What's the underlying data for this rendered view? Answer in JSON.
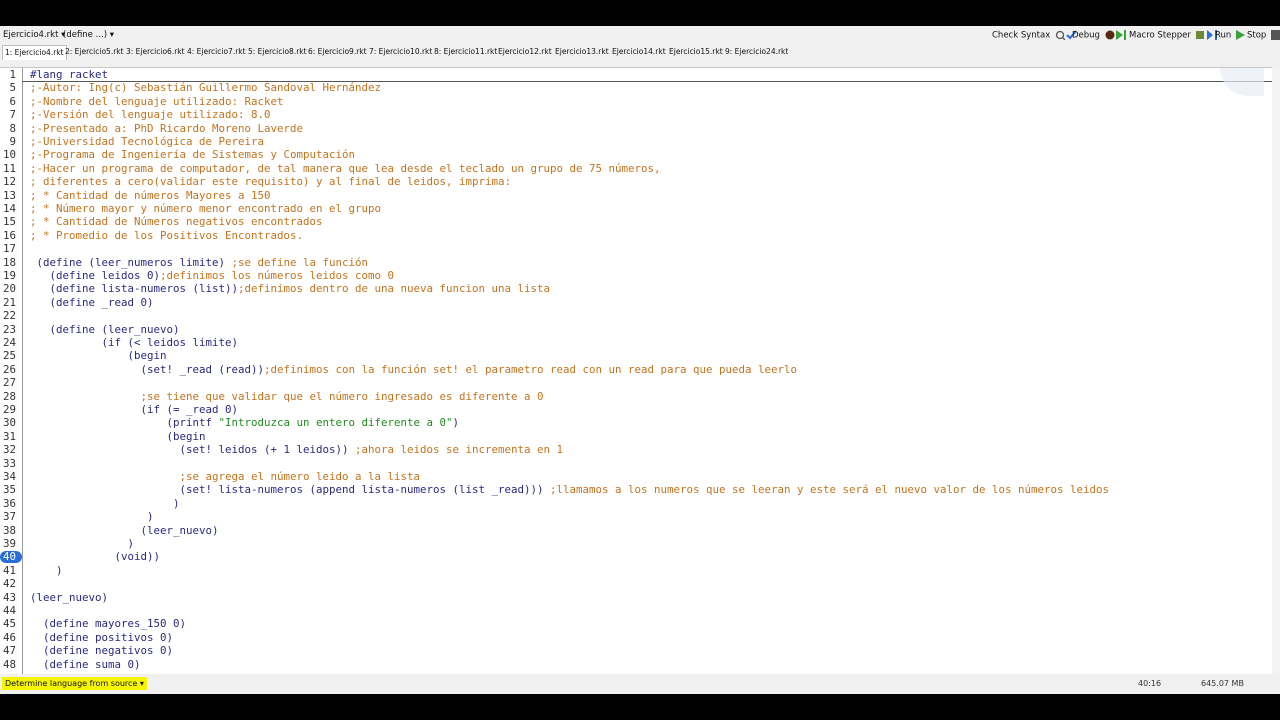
{
  "toolbar": {
    "file_selector": "Ejercicio4.rkt ▾",
    "define_selector": "(define ...) ▾",
    "check_syntax": "Check Syntax",
    "debug": "Debug",
    "macro_stepper": "Macro Stepper",
    "run": "Run",
    "stop": "Stop"
  },
  "tabs": [
    "1: Ejercicio4.rkt",
    "2: Ejercicio5.rkt",
    "3: Ejercicio6.rkt",
    "4: Ejercicio7.rkt",
    "5: Ejercicio8.rkt",
    "6: Ejercicio9.rkt",
    "7: Ejercicio10.rkt",
    "8: Ejercicio11.rkt",
    "Ejercicio12.rkt",
    "Ejercicio13.rkt",
    "Ejercicio14.rkt",
    "Ejercicio15.rkt",
    "9: Ejercicio24.rkt"
  ],
  "editor": {
    "lines": [
      {
        "n": "1",
        "t": "#lang racket"
      },
      {
        "n": "5",
        "t": ";-Autor: Ing(c) Sebastián Guillermo Sandoval Hernández"
      },
      {
        "n": "6",
        "t": ";-Nombre del lenguaje utilizado: Racket"
      },
      {
        "n": "7",
        "t": ";-Versión del lenguaje utilizado: 8.0"
      },
      {
        "n": "8",
        "t": ";-Presentado a: PhD Ricardo Moreno Laverde"
      },
      {
        "n": "9",
        "t": ";-Universidad Tecnológica de Pereira"
      },
      {
        "n": "10",
        "t": ";-Programa de Ingeniería de Sistemas y Computación"
      },
      {
        "n": "11",
        "t": ";-Hacer un programa de computador, de tal manera que lea desde el teclado un grupo de 75 números,"
      },
      {
        "n": "12",
        "t": "; diferentes a cero(validar este requisito) y al final de leidos, imprima:"
      },
      {
        "n": "13",
        "t": "; * Cantidad de números Mayores a 150"
      },
      {
        "n": "14",
        "t": "; * Número mayor y número menor encontrado en el grupo"
      },
      {
        "n": "15",
        "t": "; * Cantidad de Números negativos encontrados"
      },
      {
        "n": "16",
        "t": "; * Promedio de los Positivos Encontrados."
      },
      {
        "n": "17",
        "t": ""
      },
      {
        "n": "18",
        "t": " (define (leer_numeros limite) ;se define la función"
      },
      {
        "n": "19",
        "t": "   (define leidos 0);definimos los números leidos como 0"
      },
      {
        "n": "20",
        "t": "   (define lista-numeros (list));definimos dentro de una nueva funcion una lista"
      },
      {
        "n": "21",
        "t": "   (define _read 0)"
      },
      {
        "n": "22",
        "t": ""
      },
      {
        "n": "23",
        "t": "   (define (leer_nuevo)"
      },
      {
        "n": "24",
        "t": "           (if (< leidos limite)"
      },
      {
        "n": "25",
        "t": "               (begin"
      },
      {
        "n": "26",
        "t": "                 (set! _read (read));definimos con la función set! el parametro read con un read para que pueda leerlo"
      },
      {
        "n": "27",
        "t": ""
      },
      {
        "n": "28",
        "t": "                 ;se tiene que validar que el número ingresado es diferente a 0"
      },
      {
        "n": "29",
        "t": "                 (if (= _read 0)"
      },
      {
        "n": "30",
        "t": "                     (printf \"Introduzca un entero diferente a 0\")"
      },
      {
        "n": "31",
        "t": "                     (begin"
      },
      {
        "n": "32",
        "t": "                       (set! leidos (+ 1 leidos)) ;ahora leidos se incrementa en 1"
      },
      {
        "n": "33",
        "t": ""
      },
      {
        "n": "34",
        "t": "                       ;se agrega el número leido a la lista"
      },
      {
        "n": "35",
        "t": "                       (set! lista-numeros (append lista-numeros (list _read))) ;llamamos a los numeros que se leeran y este será el nuevo valor de los números leidos"
      },
      {
        "n": "36",
        "t": "                      )"
      },
      {
        "n": "37",
        "t": "                  )"
      },
      {
        "n": "38",
        "t": "                 (leer_nuevo)"
      },
      {
        "n": "39",
        "t": "               )"
      },
      {
        "n": "40",
        "t": "             (void))"
      },
      {
        "n": "41",
        "t": "    )"
      },
      {
        "n": "42",
        "t": ""
      },
      {
        "n": "43",
        "t": "(leer_nuevo)"
      },
      {
        "n": "44",
        "t": ""
      },
      {
        "n": "45",
        "t": "  (define mayores_150 0)"
      },
      {
        "n": "46",
        "t": "  (define positivos 0)"
      },
      {
        "n": "47",
        "t": "  (define negativos 0)"
      },
      {
        "n": "48",
        "t": "  (define suma 0)"
      }
    ],
    "breakpoint_line": "40"
  },
  "status": {
    "language": "Determine language from source ▾",
    "position": "40:16",
    "memory": "645.07 MB"
  },
  "colors": {
    "comment": "#c2741f",
    "code": "#2a2a80",
    "string": "#228b22",
    "language_bg": "#f5f500",
    "breakpoint": "#2a6fd6"
  }
}
